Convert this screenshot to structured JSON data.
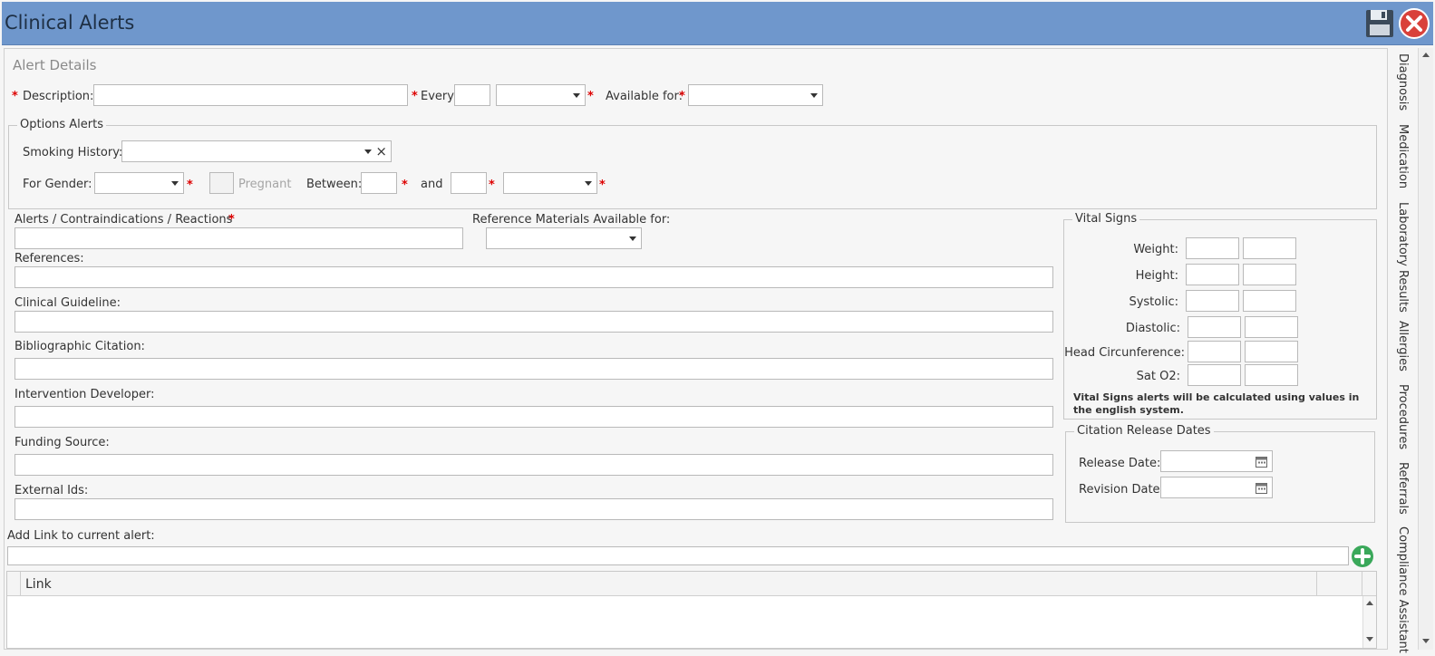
{
  "window": {
    "title": "Clinical Alerts"
  },
  "alert_details": {
    "section_title": "Alert Details",
    "description_label": "Description:",
    "every_label": "Every:",
    "available_label": "Available for:"
  },
  "options": {
    "legend": "Options Alerts",
    "smoking_label": "Smoking History:",
    "clear_glyph": "×",
    "gender_label": "For Gender:",
    "pregnant_label": "Pregnant",
    "between_label": "Between:",
    "and_label": "and"
  },
  "fields": {
    "alerts_label": "Alerts / Contraindications / Reactions",
    "refmat_label": "Reference Materials Available for:",
    "references_label": "References:",
    "guideline_label": "Clinical Guideline:",
    "citation_label": "Bibliographic Citation:",
    "developer_label": "Intervention Developer:",
    "funding_label": "Funding Source:",
    "external_label": "External Ids:",
    "addlink_label": "Add Link to current alert:"
  },
  "vitals": {
    "legend": "Vital Signs",
    "weight": "Weight:",
    "height": "Height:",
    "systolic": "Systolic:",
    "diastolic": "Diastolic:",
    "head": "Head Circunference:",
    "sat": "Sat O2:",
    "note": "Vital Signs alerts will be calculated using values in the english system."
  },
  "release": {
    "legend": "Citation Release Dates",
    "release_label": "Release Date:",
    "revision_label": "Revision Date:"
  },
  "grid": {
    "column_link": "Link"
  },
  "side_tabs": [
    "Diagnosis",
    "Medication",
    "Laboratory Results",
    "Allergies",
    "Procedures",
    "Referrals",
    "Compliance Assistant"
  ],
  "required_mark": "*",
  "colors": {
    "titlebar": "#6f97cc",
    "required": "#dd0000",
    "add_green": "#3aa85a",
    "close_red": "#d9413a"
  }
}
